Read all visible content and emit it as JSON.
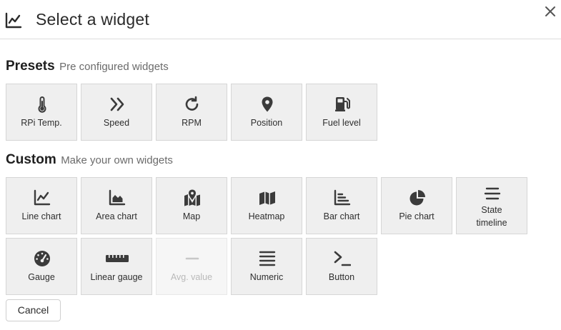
{
  "header": {
    "title": "Select a widget",
    "icon": "line-chart-icon",
    "close_icon": "close-icon"
  },
  "presets": {
    "title": "Presets",
    "subtitle": "Pre configured widgets",
    "items": [
      {
        "label": "RPi Temp.",
        "icon": "thermometer-icon"
      },
      {
        "label": "Speed",
        "icon": "double-chevron-right-icon"
      },
      {
        "label": "RPM",
        "icon": "rotate-right-icon"
      },
      {
        "label": "Position",
        "icon": "map-pin-icon"
      },
      {
        "label": "Fuel level",
        "icon": "gas-pump-icon"
      }
    ]
  },
  "custom": {
    "title": "Custom",
    "subtitle": "Make your own widgets",
    "items": [
      {
        "label": "Line chart",
        "icon": "line-chart-icon"
      },
      {
        "label": "Area chart",
        "icon": "area-chart-icon"
      },
      {
        "label": "Map",
        "icon": "map-location-icon"
      },
      {
        "label": "Heatmap",
        "icon": "folded-map-icon"
      },
      {
        "label": "Bar chart",
        "icon": "bar-chart-icon"
      },
      {
        "label": "Pie chart",
        "icon": "pie-chart-icon"
      },
      {
        "label_line1": "State",
        "label_line2": "timeline",
        "icon": "timeline-bars-icon"
      },
      {
        "label": "Gauge",
        "icon": "gauge-icon"
      },
      {
        "label": "Linear gauge",
        "icon": "ruler-icon"
      },
      {
        "label": "Avg. value",
        "icon": "minus-icon",
        "disabled": true
      },
      {
        "label": "Numeric",
        "icon": "align-justify-icon"
      },
      {
        "label": "Button",
        "icon": "terminal-prompt-icon"
      }
    ]
  },
  "footer": {
    "cancel_label": "Cancel"
  },
  "colors": {
    "tile_bg": "#efefef",
    "tile_border": "#d6d6d6",
    "icon": "#3b3b3b",
    "disabled_text": "#b9b9b9"
  }
}
